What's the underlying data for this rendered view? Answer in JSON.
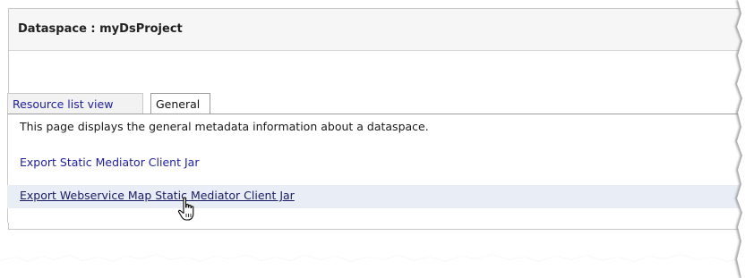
{
  "panel": {
    "title": "Dataspace : myDsProject"
  },
  "tabs": [
    {
      "label": "Resource list view",
      "active": false
    },
    {
      "label": "General",
      "active": true
    }
  ],
  "general": {
    "description": "This page displays the general metadata information about a dataspace.",
    "links": [
      {
        "label": "Export Static Mediator Client Jar",
        "hovered": false
      },
      {
        "label": "Export Webservice Map Static Mediator Client Jar",
        "hovered": true
      }
    ]
  },
  "colors": {
    "link": "#1d1dab",
    "header_bg": "#f6f6f6",
    "hover_row": "#e9eef6",
    "border": "#c9c9c9"
  },
  "icons": {
    "cursor": "hand-pointer-icon"
  }
}
